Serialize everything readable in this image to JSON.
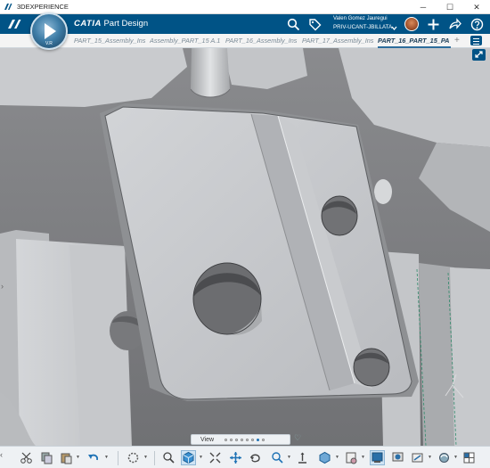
{
  "window": {
    "title": "3DEXPERIENCE",
    "minimize": "─",
    "maximize": "☐",
    "close": "✕"
  },
  "header": {
    "brand": "CATIA",
    "app_name": "Part Design",
    "compass_version": "V.R",
    "user_name": "Valen Gomez Jauregui",
    "user_org": "PRIV-UCANT-JBILLATA",
    "icons": [
      "search-icon",
      "tag-icon",
      "add-icon",
      "share-icon",
      "help-icon"
    ]
  },
  "tabs": [
    {
      "label": "PART_15_Assembly_Ins"
    },
    {
      "label": "Assembly_PART_15 A.1"
    },
    {
      "label": "PART_16_Assembly_Ins"
    },
    {
      "label": "PART_17_Assembly_Ins"
    },
    {
      "label": "PART_16_PART_15_PA",
      "active": true
    }
  ],
  "tab_add": "+",
  "viewport": {
    "description_colors": {
      "part_face": "#c4c6c9",
      "part_shadow": "#8c8e91",
      "background": "#7f8083"
    }
  },
  "view_pager": {
    "label": "View",
    "pages": 8,
    "active_page": 7,
    "favorite": "♡"
  },
  "action_bar": {
    "tools": [
      "cut-icon",
      "copy-icon",
      "paste-icon",
      "undo-icon",
      "snap-icon",
      "fit-all-icon",
      "view-cube-icon",
      "zoom-extent-icon",
      "pan-icon",
      "rotate-icon",
      "zoom-icon",
      "normal-view-icon",
      "iso-view-icon",
      "render-style-icon",
      "hide-show-icon",
      "shading-icon",
      "section-icon",
      "sync-icon",
      "multi-view-icon"
    ]
  },
  "colors": {
    "accent": "#005386",
    "tab_active": "#2d6d9c"
  }
}
